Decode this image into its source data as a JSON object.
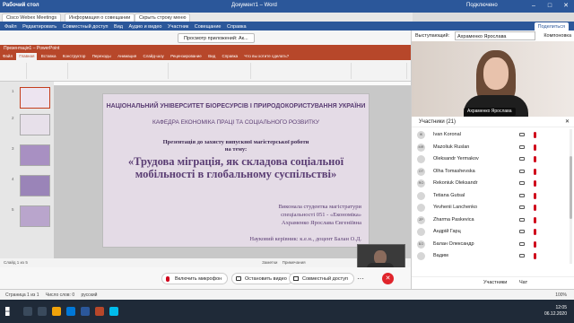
{
  "word": {
    "app": "Рабочий стол",
    "doc": "Документ1 – Word",
    "user": "Подключено",
    "menu": [
      "Файл",
      "Редактировать",
      "Совместный доступ",
      "Вид",
      "Аудио и видео",
      "Участник",
      "Совещание",
      "Справка"
    ],
    "share_label": "Поделиться",
    "status": [
      "Страница 1 из 1",
      "Число слов: 0",
      "русский"
    ],
    "zoom": "100%"
  },
  "webex": {
    "tabs": [
      "Cisco Webex Meetings",
      "Информация о совещании",
      "Скрыть строку меню"
    ],
    "share_button": "Просмотр приложений: Ак...",
    "speaker_label": "Выступающий:",
    "speaker_value": "Ахраменко Ярослава",
    "speaker_ctrl": "Компоновка",
    "video_name": "Ахраменко Ярослава",
    "participants_header": "Участники (21)",
    "participants": [
      {
        "initials": "IK",
        "name": "Ivan Koronal"
      },
      {
        "initials": "MR",
        "name": "Mazoliuk Ruslan"
      },
      {
        "initials": "",
        "name": "Oleksandr Yermakov"
      },
      {
        "initials": "OT",
        "name": "Olha Tomashevska"
      },
      {
        "initials": "RO",
        "name": "Rekoniuk Oleksandr"
      },
      {
        "initials": "",
        "name": "Tetiana Gutsal"
      },
      {
        "initials": "",
        "name": "Yevhenii Lanchenko"
      },
      {
        "initials": "ZP",
        "name": "Zharma Paskevica"
      },
      {
        "initials": "",
        "name": "Андрій Гарц"
      },
      {
        "initials": "БО",
        "name": "Балан Олександр"
      },
      {
        "initials": "",
        "name": "Вадим"
      }
    ],
    "panel_buttons": [
      "Участники",
      "Чат"
    ],
    "controls": {
      "mic": "Включить микрофон",
      "video": "Остановить видео",
      "share": "Совместный доступ"
    }
  },
  "ppt": {
    "title": "Презентація1 – PowerPoint",
    "tabs": [
      "Файл",
      "Главная",
      "Вставка",
      "Конструктор",
      "Переходы",
      "Анимация",
      "Слайд-шоу",
      "Рецензирование",
      "Вид",
      "Справка",
      "Что вы хотите сделать?"
    ],
    "status": [
      "Слайд 1 из 5",
      "Заметки",
      "Примечания"
    ],
    "slide": {
      "t1": "НАЦІОНАЛЬНИЙ УНІВЕРСИТЕТ БІОРЕСУРСІВ І ПРИРОДОКОРИСТУВАННЯ УКРАЇНИ",
      "t2": "КАФЕДРА ЕКОНОМІКА ПРАЦІ ТА СОЦІАЛЬНОГО РОЗВИТКУ",
      "t3": "Презентація до захисту випускної магістерської роботи",
      "t4": "на тему:",
      "t5": "«Трудова міграція, як складова соціальної мобільності в глобальному суспільстві»",
      "r1": "Виконала студентка магістратури",
      "r2": "спеціальності 051 - «Економіка»",
      "r3": "Ахраменко Ярослава Євгеніївна",
      "r4": "Науковий керівник: к.е.н., доцент Балан О.Д."
    }
  },
  "taskbar": {
    "time": "12:05",
    "date": "06.12.2020"
  },
  "colors": {
    "word_blue": "#2b579a",
    "ppt_red": "#b7472a",
    "slide_bg": "#e4dbe6",
    "mute_red": "#d0021b"
  }
}
